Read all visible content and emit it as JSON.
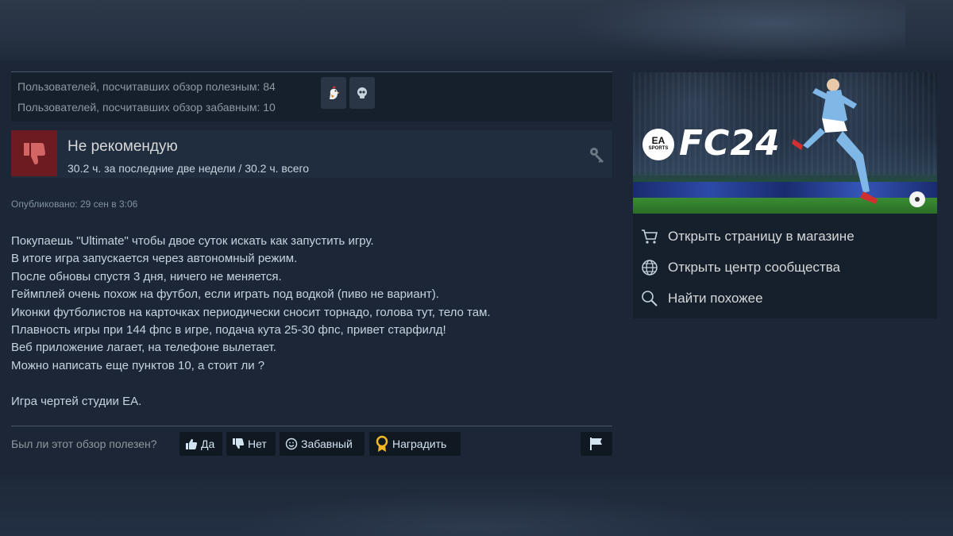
{
  "votes": {
    "helpful_text": "Пользователей, посчитавших обзор полезным: 84",
    "funny_text": "Пользователей, посчитавших обзор забавным: 10"
  },
  "recommendation": {
    "title": "Не рекомендую",
    "hours": "30.2 ч. за последние две недели / 30.2 ч. всего"
  },
  "posted": "Опубликовано: 29 сен в 3:06",
  "review_lines": [
    "Покупаешь \"Ultimate\" чтобы двое суток искать как запустить игру.",
    "В итоге игра запускается через автономный режим.",
    "После обновы спустя 3 дня, ничего не меняется.",
    "Геймплей очень похож на футбол, если играть под водкой (пиво не вариант).",
    "Иконки футболистов на карточках периодически сносит торнадо, голова тут, тело там.",
    "Плавность игры при 144 фпс в игре, подача кута 25-30 фпс, привет старфилд!",
    "Веб приложение лагает, на телефоне вылетает.",
    "Можно написать еще пунктов 10, а стоит ли ?",
    "",
    "Игра чертей студии EA."
  ],
  "helpful_bar": {
    "question": "Был ли этот обзор полезен?",
    "yes": "Да",
    "no": "Нет",
    "funny": "Забавный",
    "award": "Наградить"
  },
  "game": {
    "ea_top": "EA",
    "ea_bottom": "SPORTS",
    "logo_text": "FC24"
  },
  "side_links": {
    "store": "Открыть страницу в магазине",
    "community": "Открыть центр сообщества",
    "similar": "Найти похожее"
  },
  "colors": {
    "background": "#1b2838",
    "not_recommended": "#6c1b20",
    "text": "#c6d4df",
    "muted": "#8f98a0"
  }
}
